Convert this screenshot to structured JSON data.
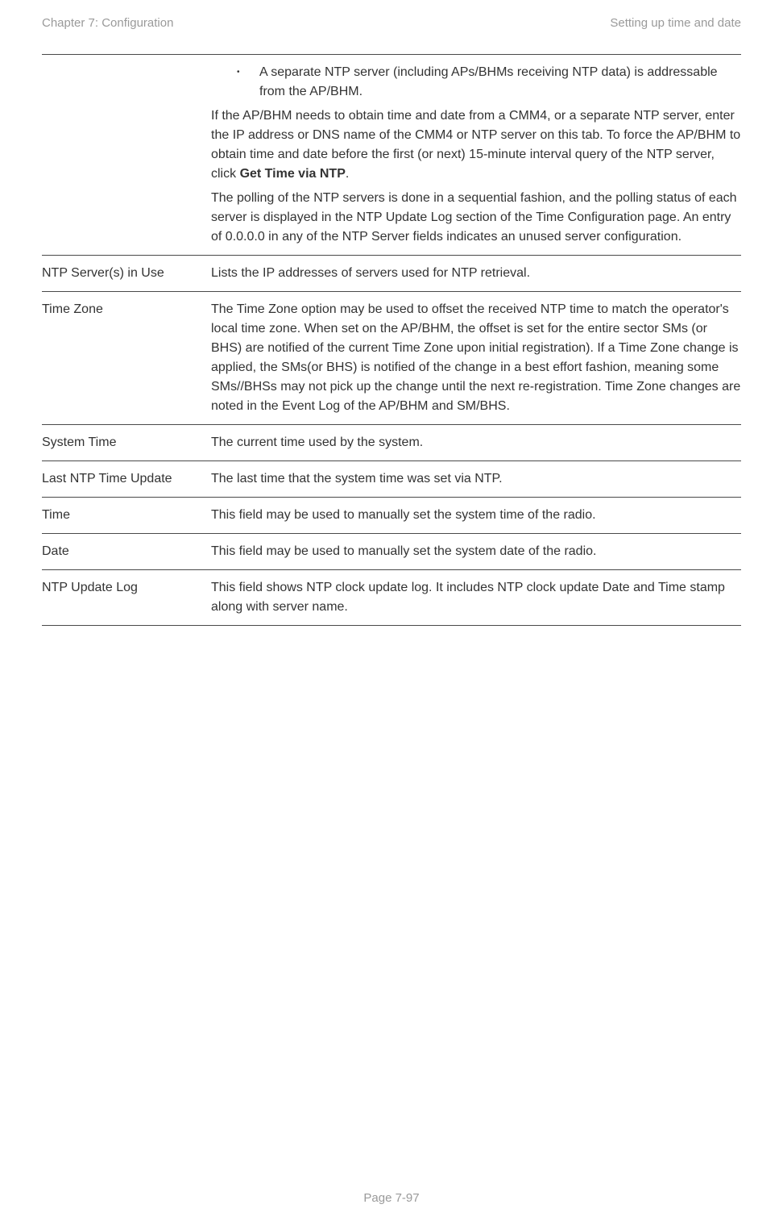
{
  "header": {
    "left": "Chapter 7:  Configuration",
    "right": "Setting up time and date"
  },
  "rows": [
    {
      "label": "",
      "content": {
        "bullet": "A separate NTP server (including APs/BHMs receiving NTP data) is addressable from the AP/BHM.",
        "para1_pre": "If the AP/BHM needs to obtain time and date from a CMM4, or a separate NTP server, enter the IP address or DNS name of the CMM4 or NTP server on this tab. To force the AP/BHM to obtain time and date before the first (or next) 15-minute interval query of the NTP server, click ",
        "para1_bold": "Get Time via NTP",
        "para1_post": ".",
        "para2": "The polling of the NTP servers is done in a sequential fashion, and the polling status of each server is displayed in the NTP Update Log section of the Time Configuration page. An entry of 0.0.0.0 in any of the NTP Server fields indicates an unused server configuration."
      }
    },
    {
      "label": "NTP Server(s) in Use",
      "desc": "Lists the IP addresses of servers used for NTP retrieval."
    },
    {
      "label": "Time Zone",
      "desc": "The Time Zone option may be used to offset the received NTP time to match the operator's local time zone. When set on the AP/BHM, the offset is set for the entire sector SMs (or BHS) are notified of the current Time Zone upon initial registration). If a Time Zone change is applied, the SMs(or BHS) is notified of the change in a best effort fashion, meaning some SMs//BHSs may not pick up the change until the next re-registration. Time Zone changes are noted in the Event Log of the AP/BHM and SM/BHS."
    },
    {
      "label": "System Time",
      "desc": "The current time used by the system."
    },
    {
      "label": "Last NTP Time Update",
      "desc": "The last time that the system time was set via NTP."
    },
    {
      "label": "Time",
      "desc": "This field may be used to manually set the system time of the radio."
    },
    {
      "label": "Date",
      "desc": "This field may be used to manually set the system date of the radio."
    },
    {
      "label": "NTP Update Log",
      "desc": "This field shows NTP clock update log. It includes NTP clock update Date and Time stamp along with server name."
    }
  ],
  "footer": "Page 7-97"
}
